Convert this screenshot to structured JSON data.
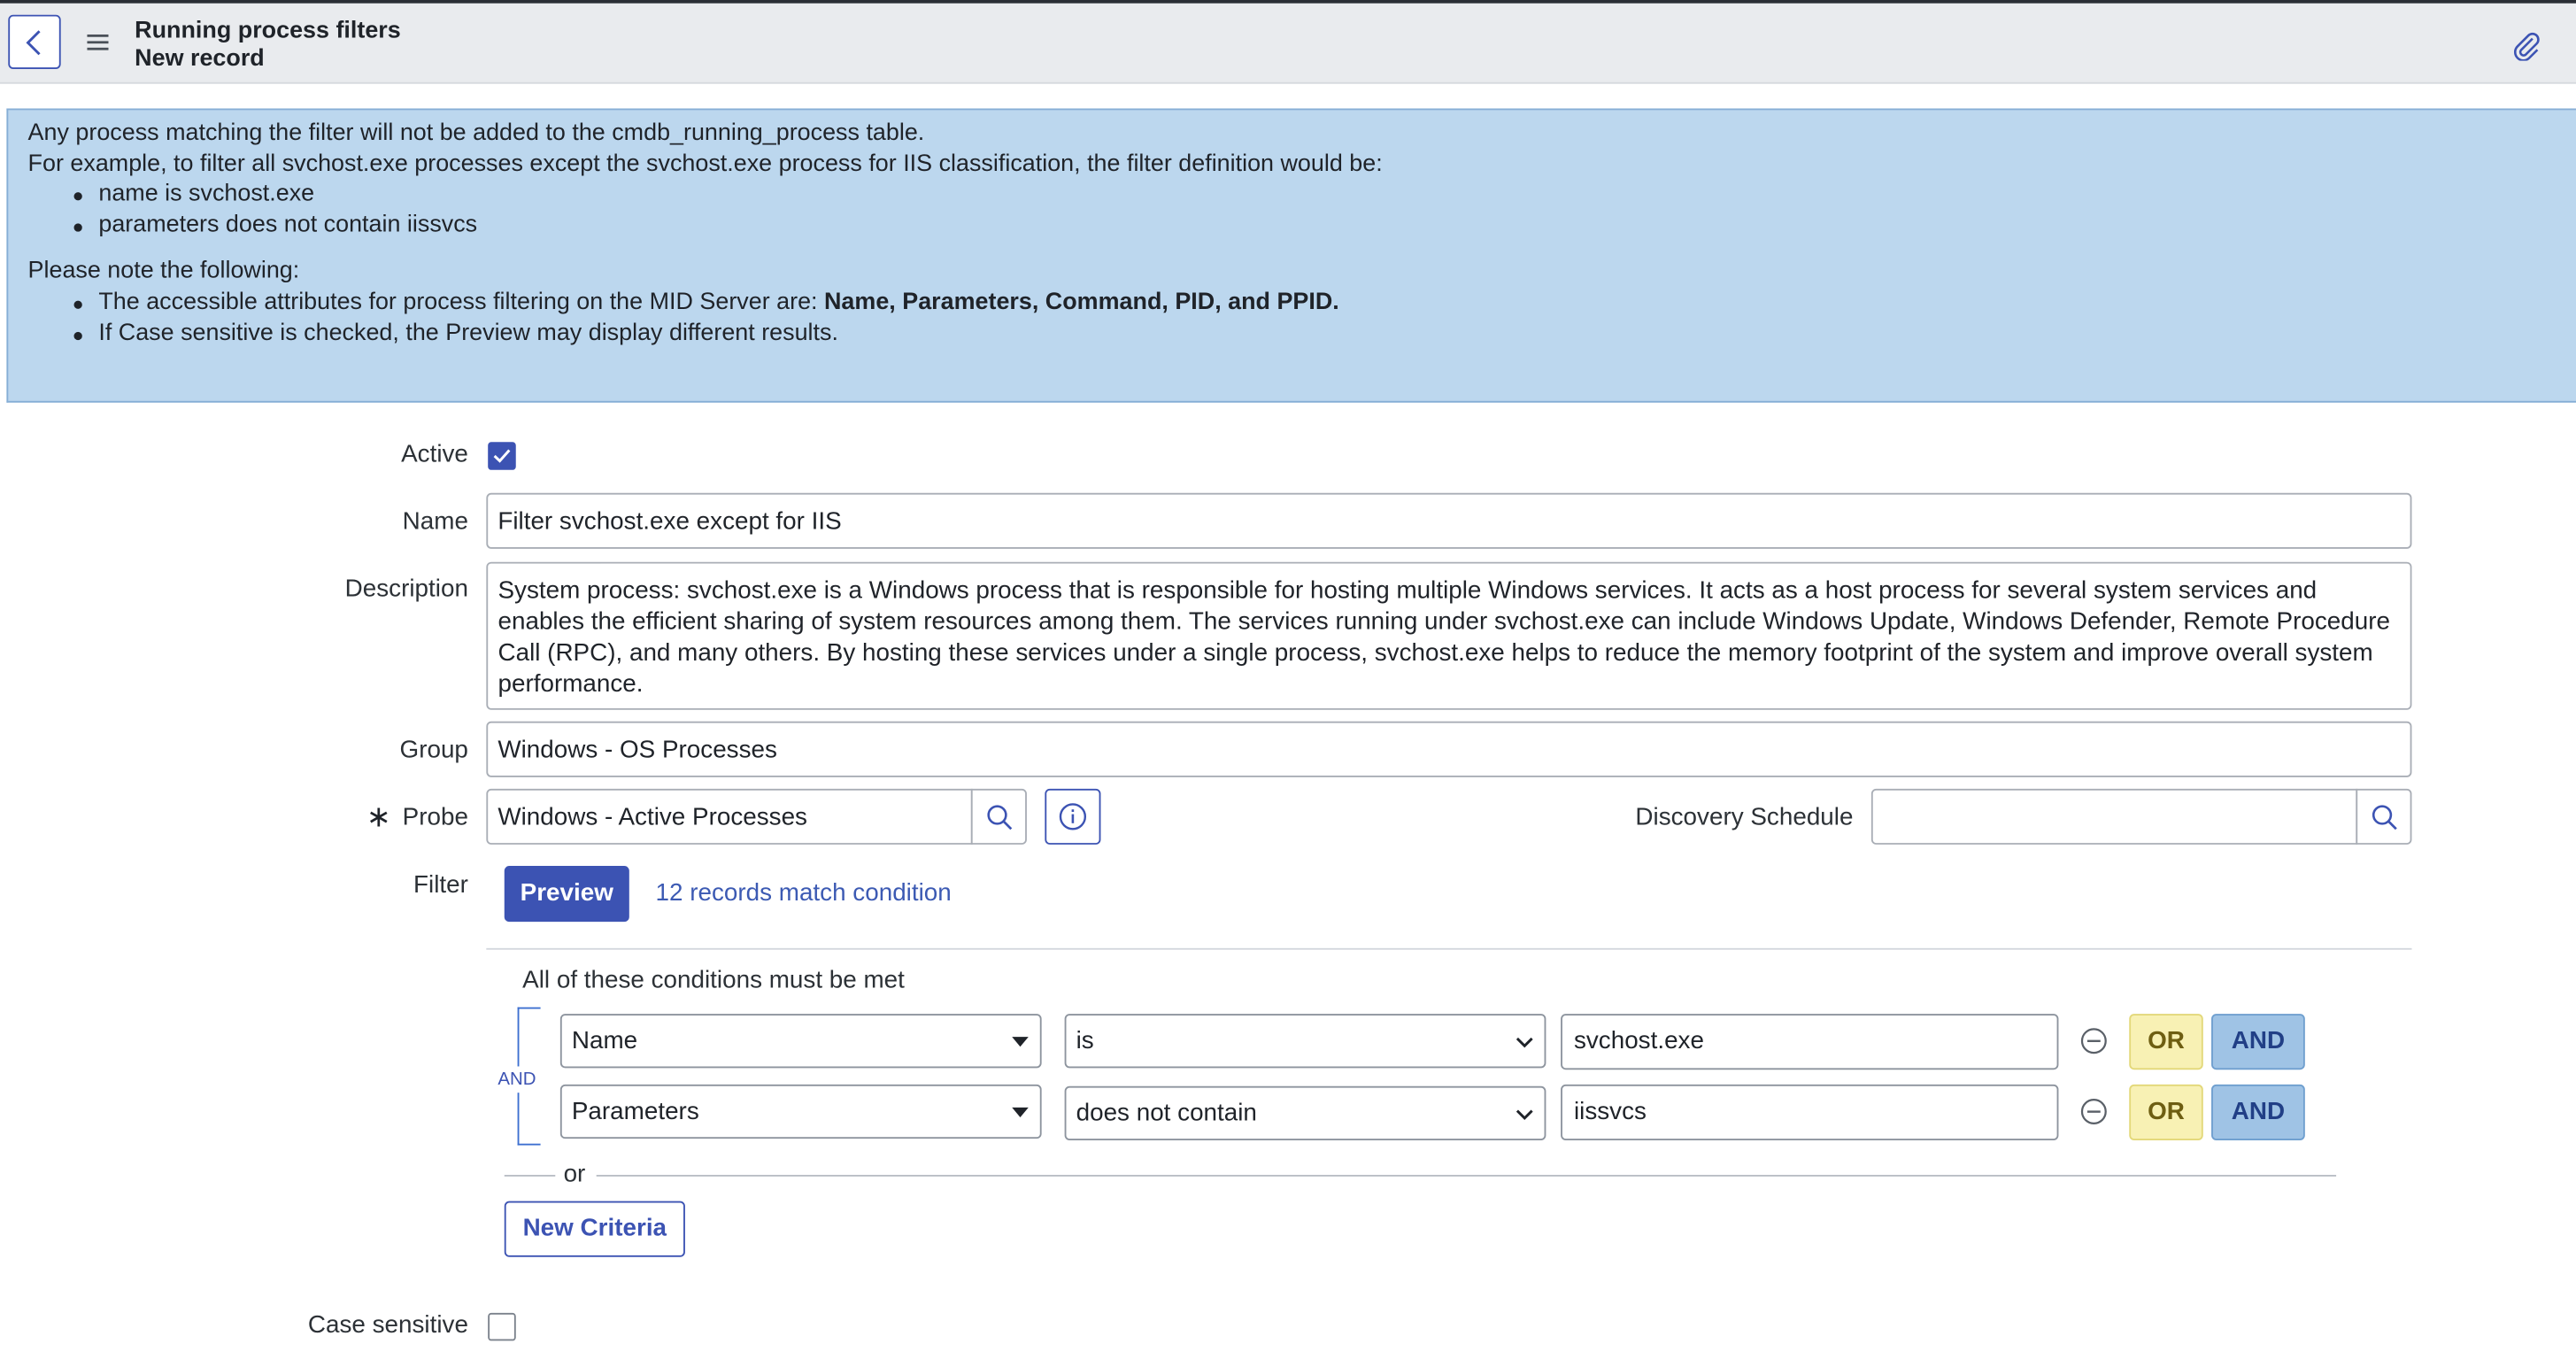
{
  "header": {
    "title": "Running process filters",
    "subtitle": "New record"
  },
  "info": {
    "line1": "Any process matching the filter will not be added to the cmdb_running_process table.",
    "line2": "For example, to filter all svchost.exe processes except the svchost.exe process for IIS classification, the filter definition would be:",
    "example_bullets": [
      "name is svchost.exe",
      "parameters does not contain iissvcs"
    ],
    "note_heading": "Please note the following:",
    "note_bullet1_prefix": "The accessible attributes for process filtering on the MID Server are: ",
    "note_bullet1_bold": "Name, Parameters, Command, PID, and PPID.",
    "note_bullet2": "If Case sensitive is checked, the Preview may display different results."
  },
  "form": {
    "active_label": "Active",
    "active_checked": true,
    "name_label": "Name",
    "name_value": "Filter svchost.exe except for IIS",
    "description_label": "Description",
    "description_value": "System process: svchost.exe is a Windows process that is responsible for hosting multiple Windows services. It acts as a host process for several system services and enables the efficient sharing of system resources among them. The services running under svchost.exe can include Windows Update, Windows Defender, Remote Procedure Call (RPC), and many others. By hosting these services under a single process, svchost.exe helps to reduce the memory footprint of the system and improve overall system performance.",
    "group_label": "Group",
    "group_value": "Windows - OS Processes",
    "probe_label": "Probe",
    "probe_required_mark": "∗",
    "probe_value": "Windows - Active Processes",
    "discovery_schedule_label": "Discovery Schedule",
    "discovery_schedule_value": "",
    "filter_label": "Filter",
    "preview_label": "Preview",
    "match_text": "12 records match condition",
    "case_sensitive_label": "Case sensitive",
    "case_sensitive_checked": false
  },
  "conditions": {
    "heading": "All of these conditions must be met",
    "and_tag": "AND",
    "rows": [
      {
        "field": "Name",
        "operator": "is",
        "value": "svchost.exe"
      },
      {
        "field": "Parameters",
        "operator": "does not contain",
        "value": "iissvcs"
      }
    ],
    "or_label": "OR",
    "and_label": "AND",
    "separator_or": "or",
    "new_criteria_label": "New Criteria"
  },
  "colors": {
    "primary": "#3c53b3",
    "info_bg": "#bcd7ee",
    "or_bg": "#f8f1b4",
    "and_bg": "#9fc3e5"
  }
}
